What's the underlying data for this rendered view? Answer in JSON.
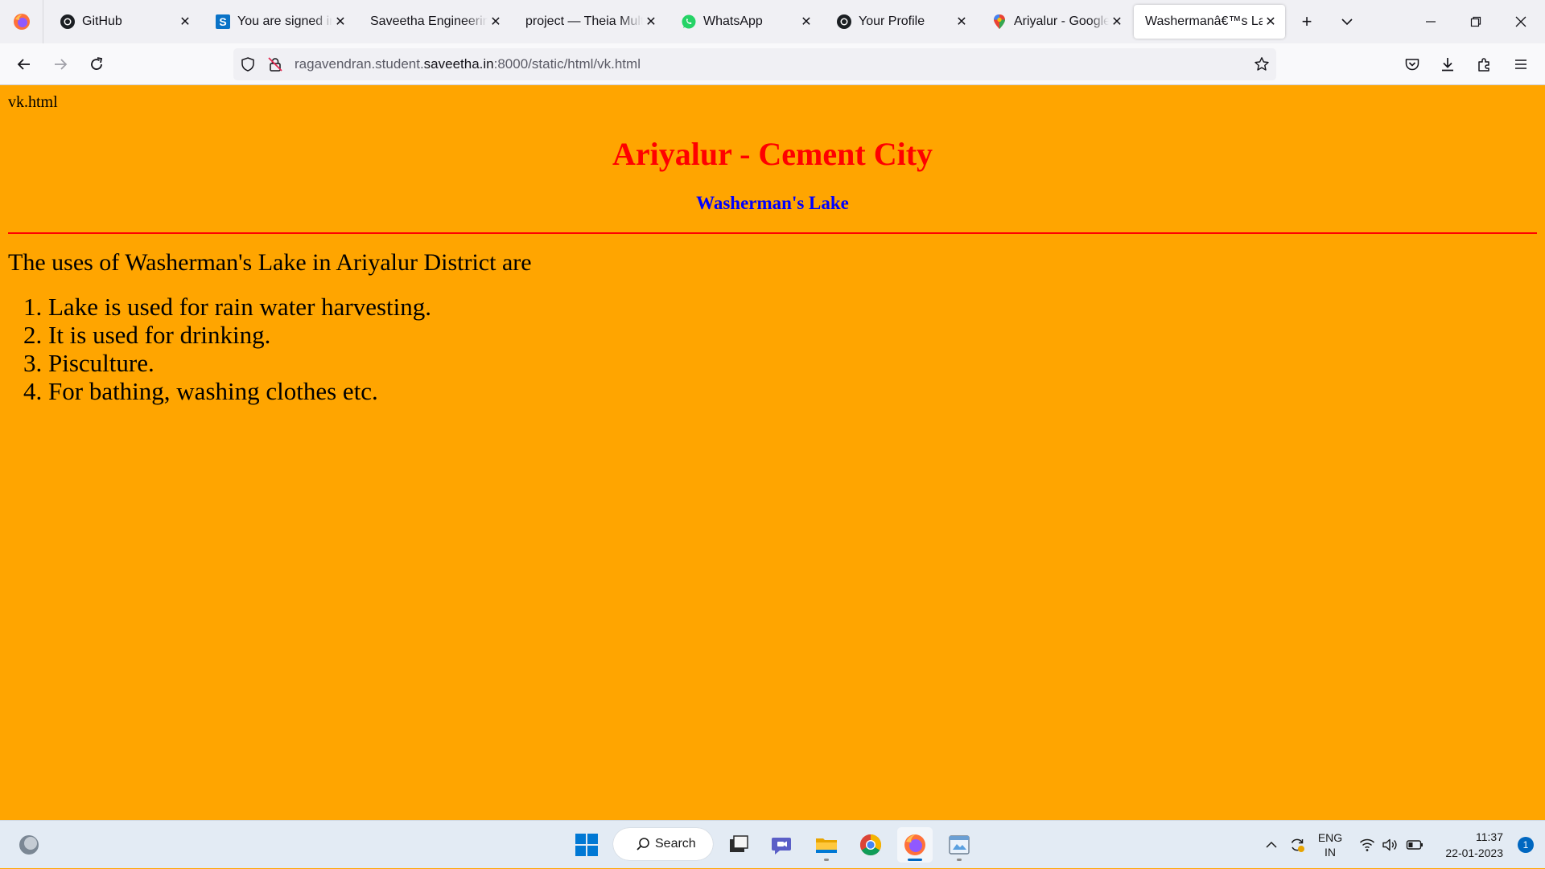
{
  "tabs": [
    {
      "title": "GitHub",
      "icon": "github-icon"
    },
    {
      "title": "You are signed in as",
      "icon": "s-logo-icon"
    },
    {
      "title": "Saveetha Engineering C",
      "icon": "none"
    },
    {
      "title": "project — Theia Multi",
      "icon": "none"
    },
    {
      "title": "WhatsApp",
      "icon": "whatsapp-icon"
    },
    {
      "title": "Your Profile",
      "icon": "github-icon"
    },
    {
      "title": "Ariyalur - Google Maps",
      "icon": "google-maps-icon"
    },
    {
      "title": "Washermanâ€™s Lake",
      "icon": "none",
      "active": true
    }
  ],
  "address": {
    "prefix": "ragavendran.student.",
    "domain": "saveetha.in",
    "suffix": ":8000/static/html/vk.html"
  },
  "page": {
    "file_label": "vk.html",
    "heading": "Ariyalur - Cement City",
    "subheading": "Washerman's Lake",
    "intro": "The uses of Washerman's Lake in Ariyalur District are",
    "items": [
      "Lake is used for rain water harvesting.",
      "It is used for drinking.",
      "Pisculture.",
      "For bathing, washing clothes etc."
    ]
  },
  "taskbar": {
    "search_label": "Search",
    "lang_top": "ENG",
    "lang_bottom": "IN",
    "time": "11:37",
    "date": "22-01-2023",
    "notification_count": "1"
  },
  "colors": {
    "page_bg": "#ffa500",
    "heading": "#ff0000",
    "subheading": "#0000ff",
    "rule": "#ff0000"
  }
}
